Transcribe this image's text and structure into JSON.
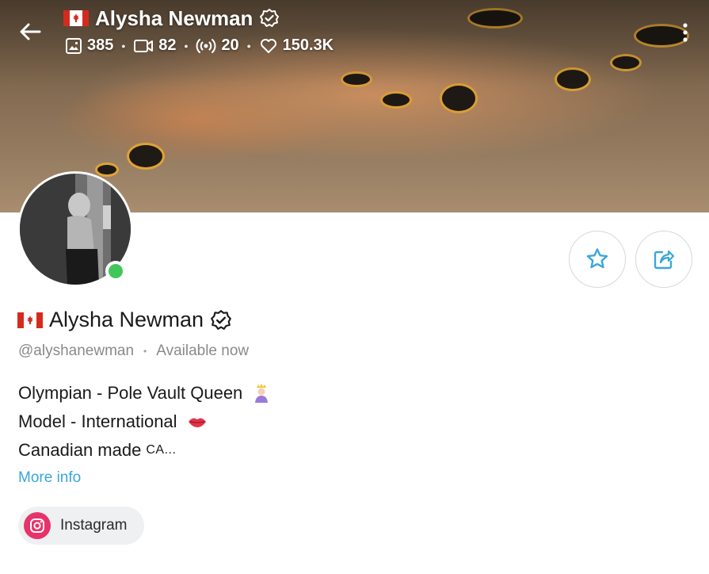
{
  "header": {
    "title": "Alysha Newman",
    "stats": {
      "photos": "385",
      "videos": "82",
      "streams": "20",
      "likes": "150.3K"
    }
  },
  "profile": {
    "name": "Alysha Newman",
    "handle": "@alyshanewman",
    "status": "Available now",
    "online": true
  },
  "bio": {
    "line1": "Olympian - Pole Vault Queen",
    "line2": "Model - International",
    "line3": "Canadian made",
    "line3_suffix": "CA..."
  },
  "more_info_label": "More info",
  "social": {
    "label": "Instagram"
  },
  "colors": {
    "accent": "#3aa7d8",
    "online": "#42c65a",
    "instagram": "#e8336a",
    "chip_bg": "#eef0f2"
  },
  "icons": [
    "back-arrow-icon",
    "verified-icon",
    "image-icon",
    "video-icon",
    "broadcast-icon",
    "heart-icon",
    "more-vertical-icon",
    "star-icon",
    "share-icon",
    "instagram-icon",
    "flag-canada-icon"
  ]
}
